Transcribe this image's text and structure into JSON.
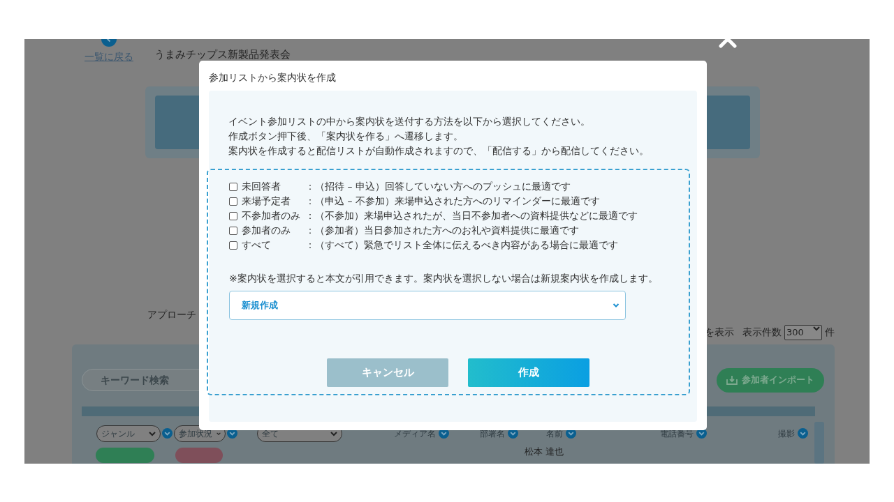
{
  "background_page": {
    "back_link": "一覧に戻る",
    "event_title": "うまみチップス新製品発表会",
    "section_label": "アプローチ",
    "display_toggle": "を表示",
    "page_size_label": "表示件数",
    "page_size": "300",
    "page_size_unit": "件",
    "search": {
      "placeholder": "キーワード検索"
    },
    "import_button": "参加者インポート",
    "filters": [
      {
        "value": "ジャンル"
      },
      {
        "value": "参加状況"
      },
      {
        "value": "全て"
      }
    ],
    "columns": [
      "メディア名",
      "部署名",
      "名前",
      "電話番号",
      "撮影"
    ],
    "first_row_name": "松本 達也"
  },
  "modal": {
    "title": "参加リストから案内状を作成",
    "description": [
      "イベント参加リストの中から案内状を送付する方法を以下から選択してください。",
      "作成ボタン押下後、「案内状を作る」へ遷移します。",
      "案内状を作成すると配信リストが自動作成されますので、「配信する」から配信してください。"
    ],
    "options": [
      {
        "label": "未回答者",
        "description": "：（招待 – 申込）回答していない方へのプッシュに最適です",
        "checked": false
      },
      {
        "label": "来場予定者",
        "description": "：（申込 – 不参加）来場申込された方へのリマインダーに最適です",
        "checked": false
      },
      {
        "label": "不参加者のみ",
        "description": "：（不参加）来場申込されたが、当日不参加者への資料提供などに最適です",
        "checked": false
      },
      {
        "label": "参加者のみ",
        "description": "：（参加者）当日参加された方へのお礼や資料提供に最適です",
        "checked": false
      },
      {
        "label": "すべて",
        "description": "：（すべて）緊急でリスト全体に伝えるべき内容がある場合に最適です",
        "checked": false
      }
    ],
    "note": "※案内状を選択すると本文が引用できます。案内状を選択しない場合は新規案内状を作成します。",
    "template_select": {
      "value": "新規作成"
    },
    "buttons": [
      {
        "label": "キャンセル",
        "kind": "secondary"
      },
      {
        "label": "作成",
        "kind": "primary"
      }
    ]
  }
}
